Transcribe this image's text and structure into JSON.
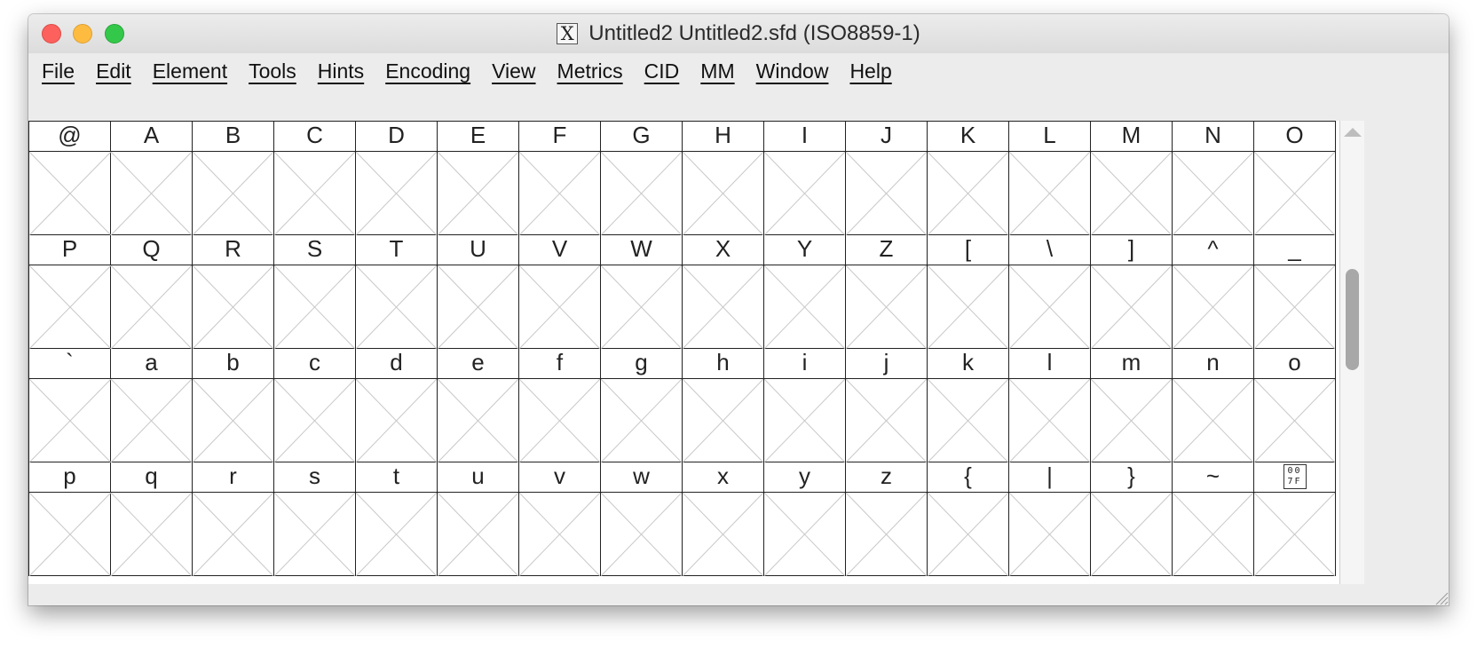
{
  "window": {
    "title": "Untitled2  Untitled2.sfd (ISO8859-1)",
    "app_icon": "X",
    "traffic_lights": {
      "close": "#fc615d",
      "minimize": "#fdbc40",
      "maximize": "#34c84a"
    }
  },
  "menu": {
    "items": [
      {
        "label": "File"
      },
      {
        "label": "Edit"
      },
      {
        "label": "Element"
      },
      {
        "label": "Tools"
      },
      {
        "label": "Hints"
      },
      {
        "label": "Encoding"
      },
      {
        "label": "View"
      },
      {
        "label": "Metrics"
      },
      {
        "label": "CID"
      },
      {
        "label": "MM"
      },
      {
        "label": "Window"
      },
      {
        "label": "Help"
      }
    ]
  },
  "glyph_grid": {
    "columns": 16,
    "rows": [
      [
        "@",
        "A",
        "B",
        "C",
        "D",
        "E",
        "F",
        "G",
        "H",
        "I",
        "J",
        "K",
        "L",
        "M",
        "N",
        "O"
      ],
      [
        "P",
        "Q",
        "R",
        "S",
        "T",
        "U",
        "V",
        "W",
        "X",
        "Y",
        "Z",
        "[",
        "\\",
        "]",
        "^",
        "_"
      ],
      [
        "`",
        "a",
        "b",
        "c",
        "d",
        "e",
        "f",
        "g",
        "h",
        "i",
        "j",
        "k",
        "l",
        "m",
        "n",
        "o"
      ],
      [
        "p",
        "q",
        "r",
        "s",
        "t",
        "u",
        "v",
        "w",
        "x",
        "y",
        "z",
        "{",
        "|",
        "}",
        "~",
        "007F"
      ]
    ],
    "special_cells": {
      "3-15": {
        "type": "unicode-box",
        "hex_top": "00",
        "hex_bottom": "7F"
      }
    },
    "empty_glyph_icon": "empty-glyph-cross-icon"
  },
  "scrollbar": {
    "thumb_position_fraction": 0.29,
    "thumb_size_fraction": 0.22
  }
}
